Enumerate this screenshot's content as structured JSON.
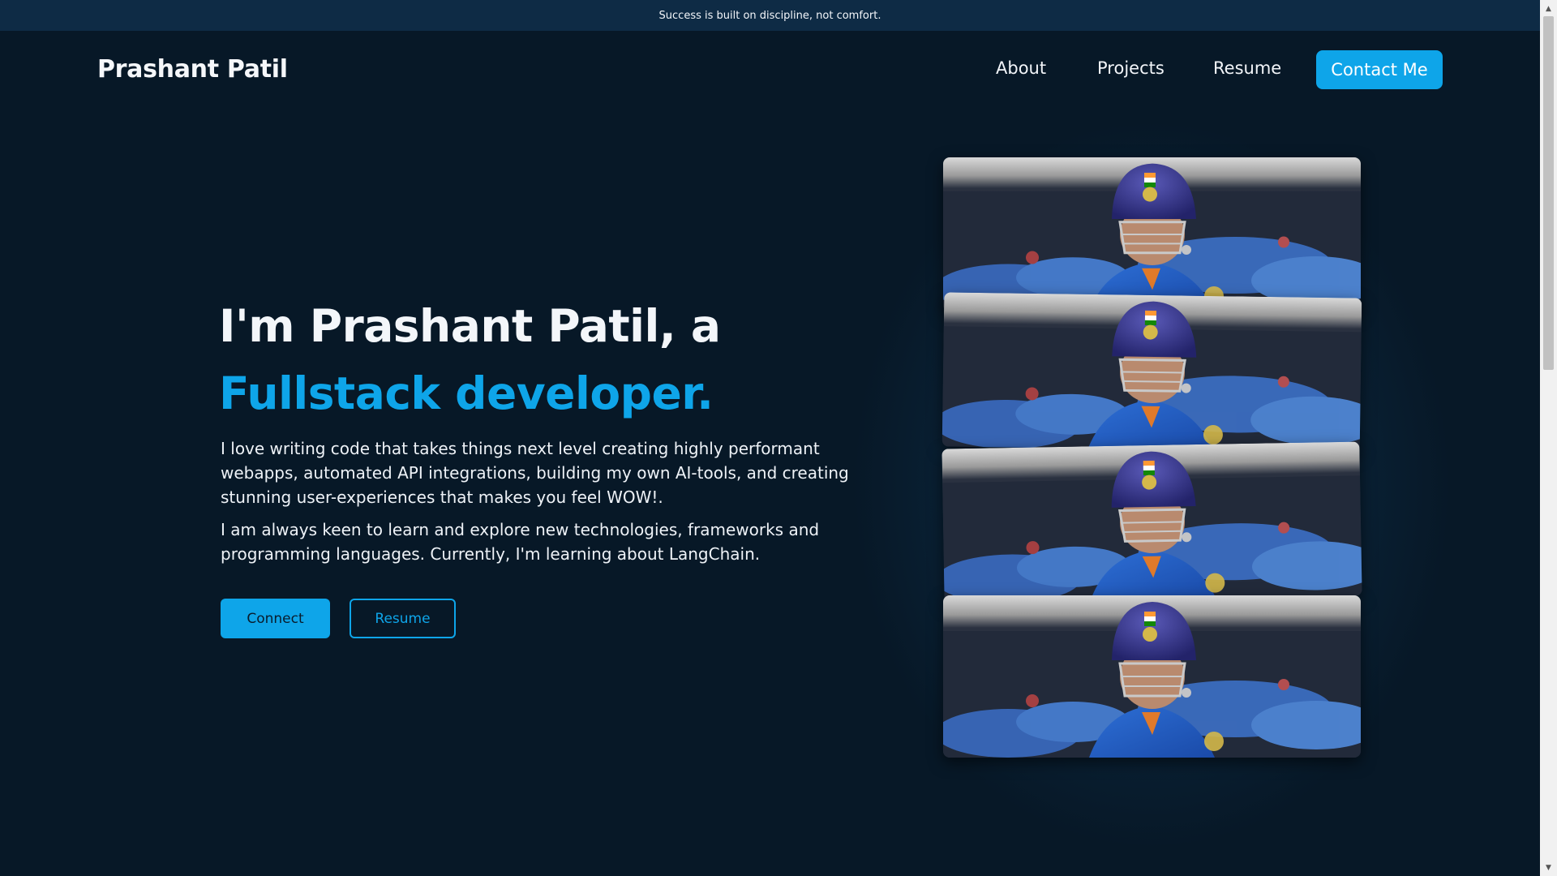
{
  "announcement": "Success is built on discipline, not comfort.",
  "header": {
    "brand": "Prashant Patil",
    "nav": [
      "About",
      "Projects",
      "Resume"
    ],
    "contact_label": "Contact Me"
  },
  "hero": {
    "line1": "I'm Prashant Patil, a",
    "line2": "Fullstack developer.",
    "paragraph1": "I love writing code that takes things next level creating highly performant webapps, automated API integrations, building my own AI-tools, and creating stunning user-experiences that makes you feel WOW!.",
    "paragraph2": "I am always keen to learn and explore new technologies, frameworks and programming languages. Currently, I'm learning about LangChain.",
    "connect_label": "Connect",
    "resume_label": "Resume"
  },
  "colors": {
    "background": "#071827",
    "announcement_bar": "#0e2b45",
    "accent": "#0ea5e9"
  },
  "icons": {
    "scroll_up": "scroll-up-arrow-icon",
    "scroll_down": "scroll-down-arrow-icon"
  }
}
